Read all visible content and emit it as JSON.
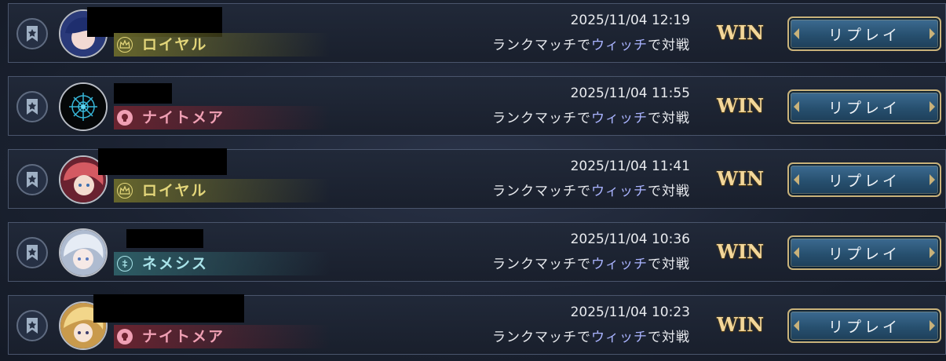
{
  "matches": [
    {
      "date": "2025/11/04 12:19",
      "class": "ロイヤル",
      "class_icon": "crown-icon",
      "class_color": "#e3d67a",
      "bar_color": "#6b6a2c",
      "mode": "ランクマッチで",
      "opponent_class": "ウィッチ",
      "suffix": "で対戦",
      "result": "WIN",
      "replay_label": "リプレイ"
    },
    {
      "date": "2025/11/04 11:55",
      "class": "ナイトメア",
      "class_icon": "skull-icon",
      "class_color": "#f0a0b4",
      "bar_color": "#6e2430",
      "mode": "ランクマッチで",
      "opponent_class": "ウィッチ",
      "suffix": "で対戦",
      "result": "WIN",
      "replay_label": "リプレイ"
    },
    {
      "date": "2025/11/04 11:41",
      "class": "ロイヤル",
      "class_icon": "crown-icon",
      "class_color": "#e3d67a",
      "bar_color": "#6b6a2c",
      "mode": "ランクマッチで",
      "opponent_class": "ウィッチ",
      "suffix": "で対戦",
      "result": "WIN",
      "replay_label": "リプレイ"
    },
    {
      "date": "2025/11/04 10:36",
      "class": "ネメシス",
      "class_icon": "nemesis-icon",
      "class_color": "#a9e4ea",
      "bar_color": "#2f6068",
      "mode": "ランクマッチで",
      "opponent_class": "ウィッチ",
      "suffix": "で対戦",
      "result": "WIN",
      "replay_label": "リプレイ"
    },
    {
      "date": "2025/11/04 10:23",
      "class": "ナイトメア",
      "class_icon": "skull-icon",
      "class_color": "#f0a0b4",
      "bar_color": "#6e2430",
      "mode": "ランクマッチで",
      "opponent_class": "ウィッチ",
      "suffix": "で対戦",
      "result": "WIN",
      "replay_label": "リプレイ"
    }
  ]
}
